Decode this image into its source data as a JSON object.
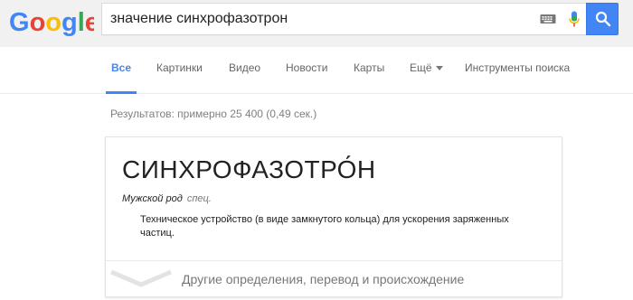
{
  "logo": {
    "alt": "Google"
  },
  "search": {
    "query": "значение синхрофазотрон",
    "keyboard_icon": "keyboard-icon",
    "mic_icon": "mic-icon",
    "search_icon": "search-icon"
  },
  "nav": {
    "tabs": [
      {
        "label": "Все",
        "active": true
      },
      {
        "label": "Картинки"
      },
      {
        "label": "Видео"
      },
      {
        "label": "Новости"
      },
      {
        "label": "Карты"
      },
      {
        "label": "Ещё"
      },
      {
        "label": "Инструменты поиска"
      }
    ]
  },
  "results_stats": "Результатов: примерно 25 400 (0,49 сек.)",
  "dictionary": {
    "word": "СИНХРОФАЗОТРО́Н",
    "part_of_speech": "Мужской род",
    "domain": "спец.",
    "definition": "Техническое устройство (в виде замкнутого кольца) для ускорения заряженных частиц.",
    "more_label": "Другие определения, перевод и происхождение"
  },
  "colors": {
    "accent": "#4285f4",
    "header_bg": "#f1f1f1"
  }
}
